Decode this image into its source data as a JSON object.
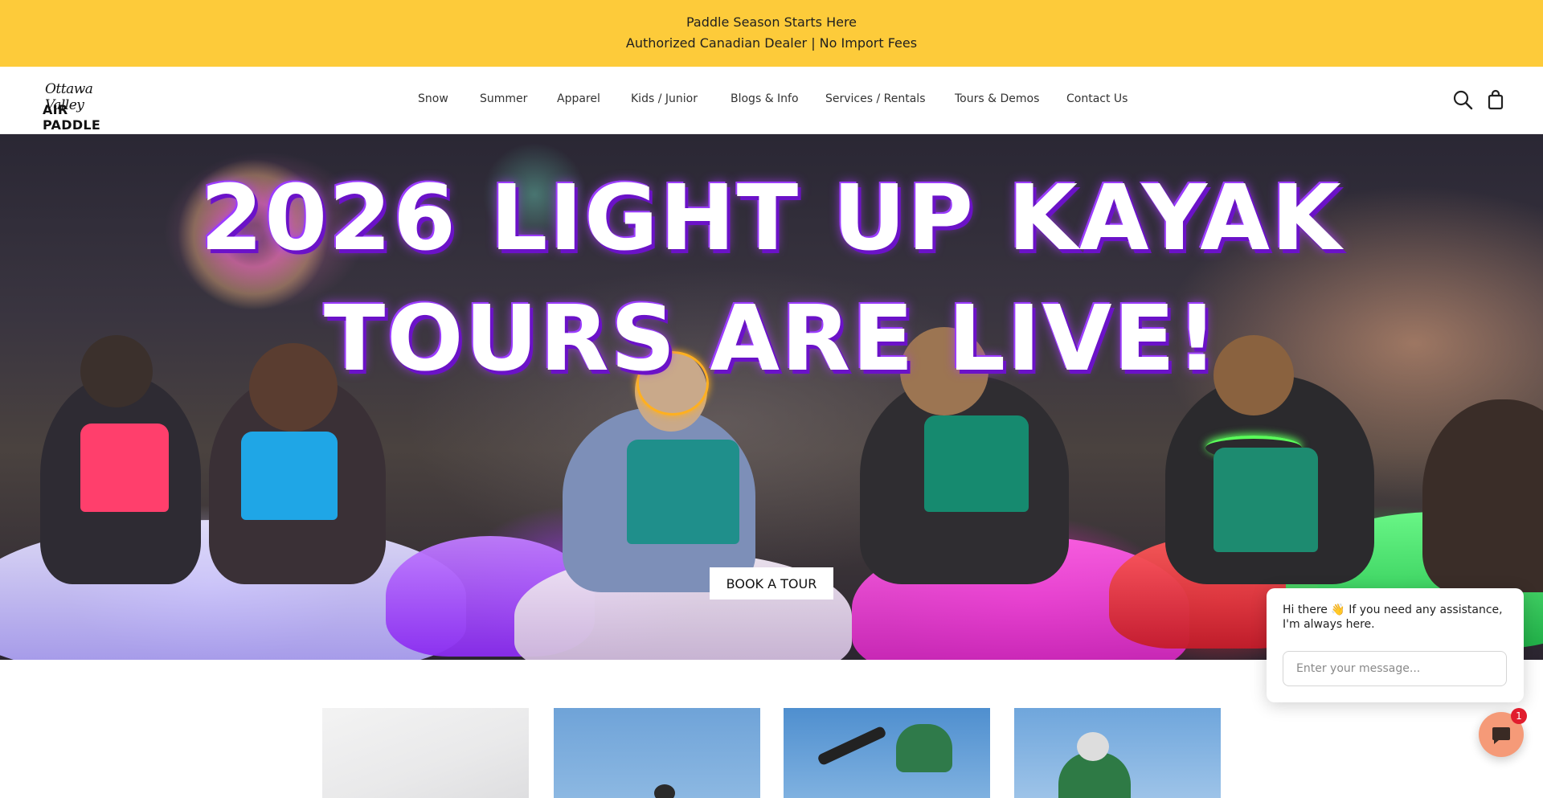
{
  "announcement": {
    "line1": "Paddle Season Starts Here",
    "line2": "Authorized Canadian Dealer | No Import Fees",
    "background": "#fdcb3a"
  },
  "header": {
    "logo": {
      "script": "Ottawa Valley",
      "brand": "AIR PADDLE"
    },
    "nav": [
      "Snow",
      "Summer",
      "Apparel",
      "Kids / Junior",
      "Blogs & Info",
      "Services / Rentals",
      "Tours & Demos",
      "Contact Us"
    ],
    "icons": [
      "search-icon",
      "shopping-bag-icon"
    ]
  },
  "hero": {
    "title_line1": "2026 LIGHT UP KAYAK",
    "title_line2": "TOURS ARE LIVE!",
    "cta": "BOOK A TOUR",
    "accent": "#6b12c8"
  },
  "collection_tiles": 4,
  "chat": {
    "greeting": "Hi there 👋 If you need any assistance, I'm always here.",
    "placeholder": "Enter your message...",
    "badge_count": "1",
    "fab_color": "#f59a78",
    "badge_color": "#e11d2e"
  }
}
